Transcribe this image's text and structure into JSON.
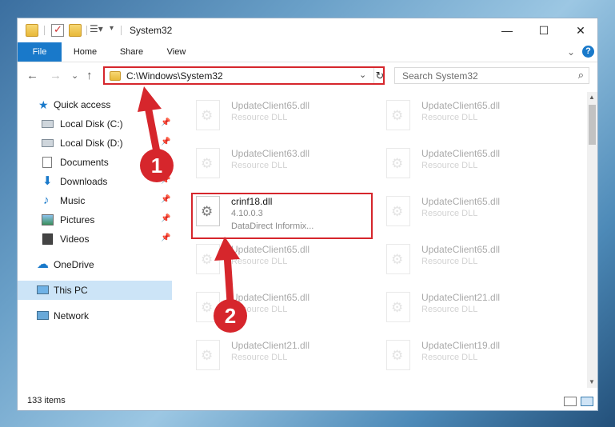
{
  "window": {
    "title": "System32",
    "controls": {
      "minimize": "—",
      "maximize": "☐",
      "close": "✕"
    }
  },
  "ribbon": {
    "tabs": [
      "File",
      "Home",
      "Share",
      "View"
    ],
    "collapse": "⌄",
    "help": "?"
  },
  "navigation": {
    "back": "←",
    "forward": "→",
    "recent": "⌄",
    "up": "↑",
    "address": "C:\\Windows\\System32",
    "address_dropdown": "⌄",
    "refresh": "↻",
    "search_placeholder": "Search System32",
    "search_icon": "search-icon"
  },
  "sidebar": {
    "items": [
      {
        "label": "Quick access",
        "icon": "star-icon",
        "pinned": false
      },
      {
        "label": "Local Disk (C:)",
        "icon": "drive-icon",
        "pinned": true
      },
      {
        "label": "Local Disk (D:)",
        "icon": "drive-icon",
        "pinned": true
      },
      {
        "label": "Documents",
        "icon": "documents-icon",
        "pinned": true
      },
      {
        "label": "Downloads",
        "icon": "downloads-icon",
        "pinned": true
      },
      {
        "label": "Music",
        "icon": "music-icon",
        "pinned": true
      },
      {
        "label": "Pictures",
        "icon": "pictures-icon",
        "pinned": true
      },
      {
        "label": "Videos",
        "icon": "videos-icon",
        "pinned": true
      },
      {
        "label": "OneDrive",
        "icon": "onedrive-icon",
        "pinned": false
      },
      {
        "label": "This PC",
        "icon": "this-pc-icon",
        "pinned": false,
        "selected": true
      },
      {
        "label": "Network",
        "icon": "network-icon",
        "pinned": false
      }
    ],
    "pin_glyph": "📌"
  },
  "files": {
    "left": [
      {
        "name": "UpdateClient65.dll",
        "desc": "Resource DLL"
      },
      {
        "name": "UpdateClient63.dll",
        "desc": "Resource DLL"
      },
      {
        "name": "crinf18.dll",
        "desc": "4.10.0.3",
        "desc2": "DataDirect Informix...",
        "highlighted": true
      },
      {
        "name": "UpdateClient65.dll",
        "desc": "Resource DLL"
      },
      {
        "name": "UpdateClient65.dll",
        "desc": "Resource DLL"
      },
      {
        "name": "UpdateClient21.dll",
        "desc": "Resource DLL"
      }
    ],
    "right": [
      {
        "name": "UpdateClient65.dll",
        "desc": "Resource DLL"
      },
      {
        "name": "UpdateClient65.dll",
        "desc": "Resource DLL"
      },
      {
        "name": "UpdateClient65.dll",
        "desc": "Resource DLL"
      },
      {
        "name": "UpdateClient65.dll",
        "desc": "Resource DLL"
      },
      {
        "name": "UpdateClient21.dll",
        "desc": "Resource DLL"
      },
      {
        "name": "UpdateClient19.dll",
        "desc": "Resource DLL"
      }
    ]
  },
  "status": {
    "item_count": "133 items"
  },
  "annotations": {
    "callout_1": "1",
    "callout_2": "2"
  },
  "colors": {
    "accent": "#1979ca",
    "annotation": "#d6262c",
    "selection": "#cce4f7"
  }
}
